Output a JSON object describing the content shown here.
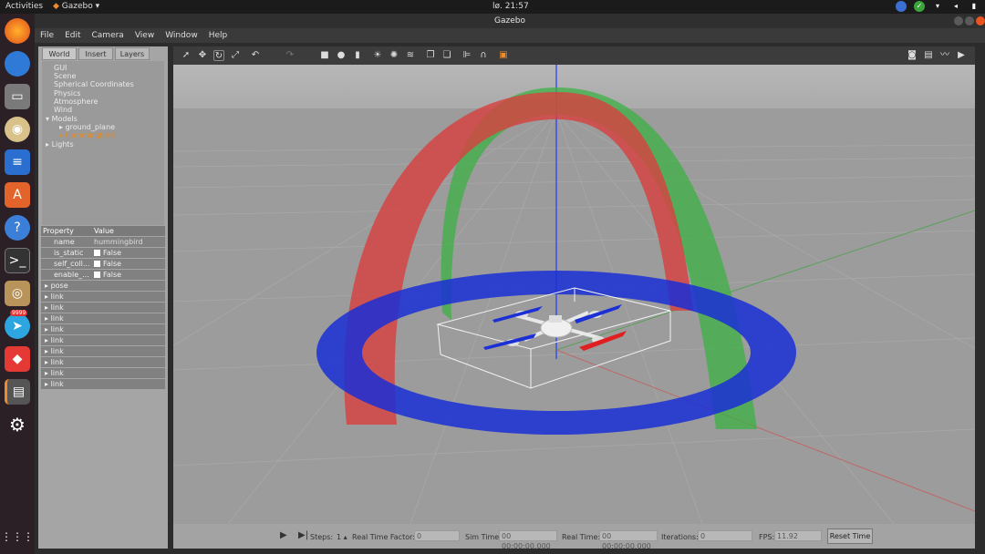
{
  "system": {
    "activities": "Activities",
    "app_menu": "Gazebo",
    "clock": "lø. 21:57"
  },
  "window": {
    "title": "Gazebo"
  },
  "dock": {
    "telegram_badge": "9999"
  },
  "menu": [
    "File",
    "Edit",
    "Camera",
    "View",
    "Window",
    "Help"
  ],
  "tabs": [
    "World",
    "Insert",
    "Layers"
  ],
  "tree": {
    "items": [
      "GUI",
      "Scene",
      "Spherical Coordinates",
      "Physics",
      "Atmosphere",
      "Wind"
    ],
    "models_label": "Models",
    "models": [
      "ground_plane",
      "hummingbird"
    ],
    "lights_label": "Lights"
  },
  "properties": {
    "header": [
      "Property",
      "Value"
    ],
    "name_label": "name",
    "name_value": "hummingbird",
    "is_static_label": "is_static",
    "is_static_value": "False",
    "self_collide_label": "self_coll...",
    "self_collide_value": "False",
    "enable_wind_label": "enable_...",
    "enable_wind_value": "False",
    "pose_label": "pose",
    "links": [
      "link",
      "link",
      "link",
      "link",
      "link",
      "link",
      "link",
      "link",
      "link"
    ]
  },
  "bottom": {
    "steps_label": "Steps:",
    "steps_value": "1",
    "rtf_label": "Real Time Factor:",
    "rtf_value": "0",
    "sim_time_label": "Sim Time:",
    "sim_time_value": "00 00:00:00.000",
    "real_time_label": "Real Time:",
    "real_time_value": "00 00:00:00.000",
    "iterations_label": "Iterations:",
    "iterations_value": "0",
    "fps_label": "FPS:",
    "fps_value": "11.92",
    "reset_label": "Reset Time"
  },
  "colors": {
    "ring_blue": "#1a2fd6",
    "arc_red": "#d84040",
    "arc_green": "#3cb043",
    "ground": "#9c9c9c",
    "sky": "#b4b4b4",
    "selected": "#e28a2a"
  }
}
